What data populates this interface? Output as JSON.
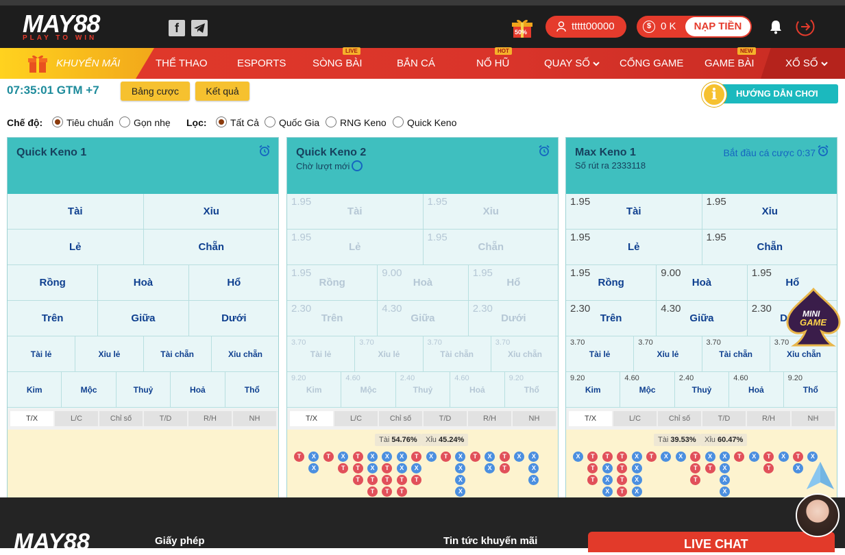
{
  "header": {
    "logo_main": "MAY88",
    "logo_tag": "PLAY TO WIN",
    "promo_badge": "50%",
    "username": "ttttt00000",
    "balance": "0 K",
    "deposit_label": "NẠP TIỀN"
  },
  "nav": {
    "promo": "KHUYẾN MÃI",
    "items": [
      {
        "label": "THỂ THAO",
        "badge": ""
      },
      {
        "label": "ESPORTS",
        "badge": ""
      },
      {
        "label": "SÒNG BÀI",
        "badge": "LIVE"
      },
      {
        "label": "BẮN CÁ",
        "badge": ""
      },
      {
        "label": "NỔ HŨ",
        "badge": "HOT"
      },
      {
        "label": "QUAY SỐ",
        "badge": ""
      },
      {
        "label": "CỔNG GAME",
        "badge": ""
      },
      {
        "label": "GAME BÀI",
        "badge": "NEW"
      },
      {
        "label": "XỔ SỐ",
        "badge": ""
      }
    ]
  },
  "toolbar": {
    "clock": "07:35:01 GTM +7",
    "bet_table": "Bảng cược",
    "results": "Kết quả",
    "guide": "HƯỚNG DẪN CHƠI",
    "guide_icon": "i"
  },
  "filters": {
    "mode_label": "Chế độ:",
    "mode_options": [
      "Tiêu chuẩn",
      "Gọn nhẹ"
    ],
    "mode_selected": 0,
    "filter_label": "Lọc:",
    "filter_options": [
      "Tất Cả",
      "Quốc Gia",
      "RNG Keno",
      "Quick Keno"
    ],
    "filter_selected": 0
  },
  "panels": [
    {
      "title": "Quick Keno 1",
      "subtitle": "",
      "status": "",
      "odds": {
        "tai": "",
        "xiu": "",
        "le": "",
        "chan": "",
        "rong": "",
        "hoa": "",
        "ho": "",
        "tren": "",
        "giua": "",
        "duoi": "",
        "taile": "",
        "xiule": "",
        "taichan": "",
        "xiuchan": "",
        "kim": "",
        "moc": "",
        "thuy": "",
        "hoa5": "",
        "tho": ""
      },
      "tai_pct": "",
      "xiu_pct": ""
    },
    {
      "title": "Quick Keno 2",
      "subtitle": "Chờ lượt mới",
      "status": "",
      "odds": {
        "tai": "1.95",
        "xiu": "1.95",
        "le": "1.95",
        "chan": "1.95",
        "rong": "1.95",
        "hoa": "9.00",
        "ho": "1.95",
        "tren": "2.30",
        "giua": "4.30",
        "duoi": "2.30",
        "taile": "3.70",
        "xiule": "3.70",
        "taichan": "3.70",
        "xiuchan": "3.70",
        "kim": "9.20",
        "moc": "4.60",
        "thuy": "2.40",
        "hoa5": "4.60",
        "tho": "9.20"
      },
      "tai_label": "Tài",
      "tai_pct": "54.76%",
      "xiu_label": "Xỉu",
      "xiu_pct": "45.24%"
    },
    {
      "title": "Max Keno 1",
      "subtitle": "Số rút ra 2333118",
      "status": "Bắt đầu cá cược 0:37",
      "odds": {
        "tai": "1.95",
        "xiu": "1.95",
        "le": "1.95",
        "chan": "1.95",
        "rong": "1.95",
        "hoa": "9.00",
        "ho": "1.95",
        "tren": "2.30",
        "giua": "4.30",
        "duoi": "2.30",
        "taile": "3.70",
        "xiule": "3.70",
        "taichan": "3.70",
        "xiuchan": "3.70",
        "kim": "9.20",
        "moc": "4.60",
        "thuy": "2.40",
        "hoa5": "4.60",
        "tho": "9.20"
      },
      "tai_label": "Tài",
      "tai_pct": "39.53%",
      "xiu_label": "Xỉu",
      "xiu_pct": "60.47%"
    }
  ],
  "bet_names": {
    "tai": "Tài",
    "xiu": "Xỉu",
    "le": "Lẻ",
    "chan": "Chẵn",
    "rong": "Rồng",
    "hoa": "Hoà",
    "ho": "Hổ",
    "tren": "Trên",
    "giua": "Giữa",
    "duoi": "Dưới",
    "taile": "Tài lẻ",
    "xiule": "Xỉu lẻ",
    "taichan": "Tài chẵn",
    "xiuchan": "Xỉu chẵn",
    "kim": "Kim",
    "moc": "Mộc",
    "thuy": "Thuỷ",
    "hoa5": "Hoả",
    "tho": "Thổ"
  },
  "tabs": [
    "T/X",
    "L/C",
    "Chỉ số",
    "T/D",
    "R/H",
    "NH"
  ],
  "ball_letters": {
    "t": "T",
    "x": "X"
  },
  "roadmap_2": [
    "T",
    "XX",
    "T",
    "XT",
    "TTT",
    "XXTT",
    "XTTT",
    "XXTTT",
    "TXT",
    "X",
    "T",
    "XXXXX",
    "T",
    "XX",
    "TT",
    "X",
    "XXX"
  ],
  "roadmap_3": [
    "X",
    "TTT",
    "TXXX",
    "TTTT",
    "XXXX",
    "T",
    "X",
    "X",
    "TTT",
    "XT",
    "XXXX",
    "T",
    "X",
    "TT",
    "X",
    "TX",
    "X"
  ],
  "footer": {
    "logo": "MAY88",
    "license": "Giấy phép",
    "news": "Tin tức khuyến mãi",
    "livechat": "LIVE CHAT"
  },
  "minigame": {
    "line1": "MINI",
    "line2": "GAME"
  },
  "colors": {
    "brand_red": "#e53b2c",
    "teal": "#3fbfbf",
    "gold": "#f6c12f",
    "tai": "#e1505a",
    "xiu": "#4b8fe0"
  }
}
